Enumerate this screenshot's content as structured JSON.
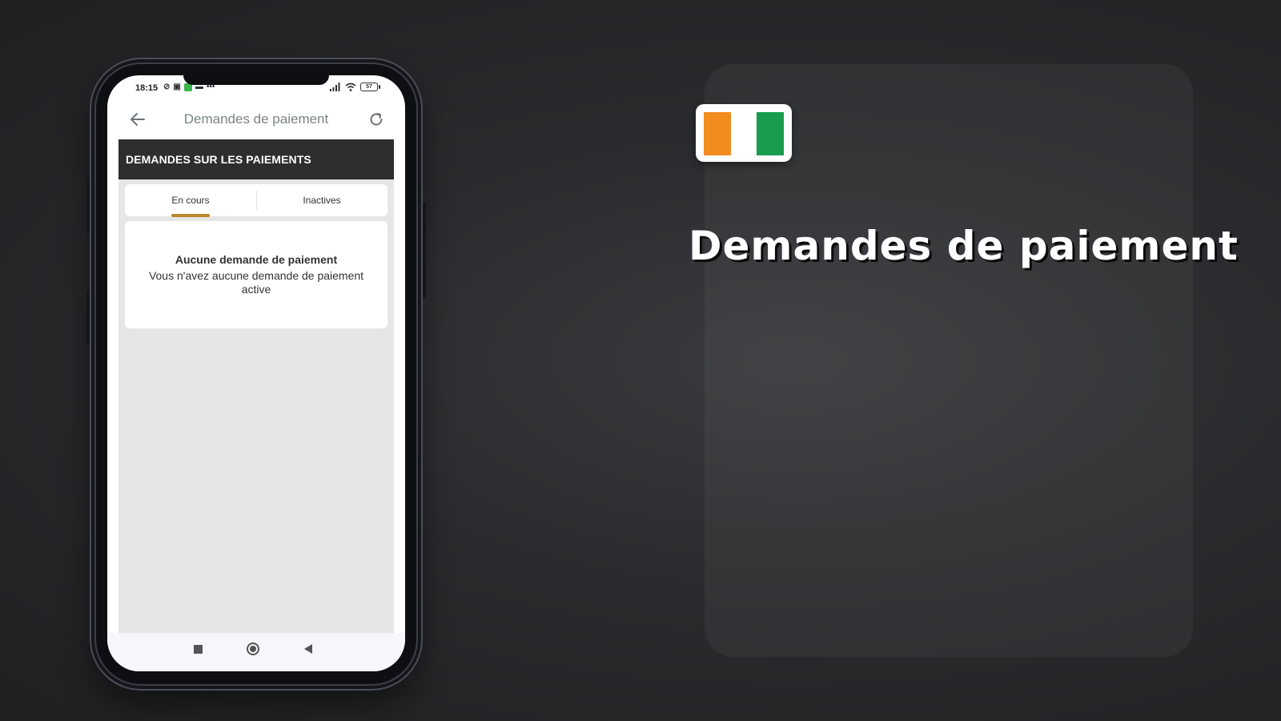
{
  "status_bar": {
    "time": "18:15",
    "battery": "57",
    "more": "•••"
  },
  "app_bar": {
    "title": "Demandes de paiement"
  },
  "section": {
    "header": "DEMANDES SUR LES PAIEMENTS"
  },
  "tabs": [
    {
      "label": "En cours",
      "active": true
    },
    {
      "label": "Inactives",
      "active": false
    }
  ],
  "empty_state": {
    "title": "Aucune demande de paiement",
    "message": "Vous n'avez aucune demande de paiement active"
  },
  "promo": {
    "title": "Demandes de paiement",
    "flag_colors": [
      "#f28c1e",
      "#ffffff",
      "#179d4d"
    ]
  },
  "colors": {
    "tab_indicator": "#b8892a",
    "section_header_bg": "#2e2e2e"
  }
}
